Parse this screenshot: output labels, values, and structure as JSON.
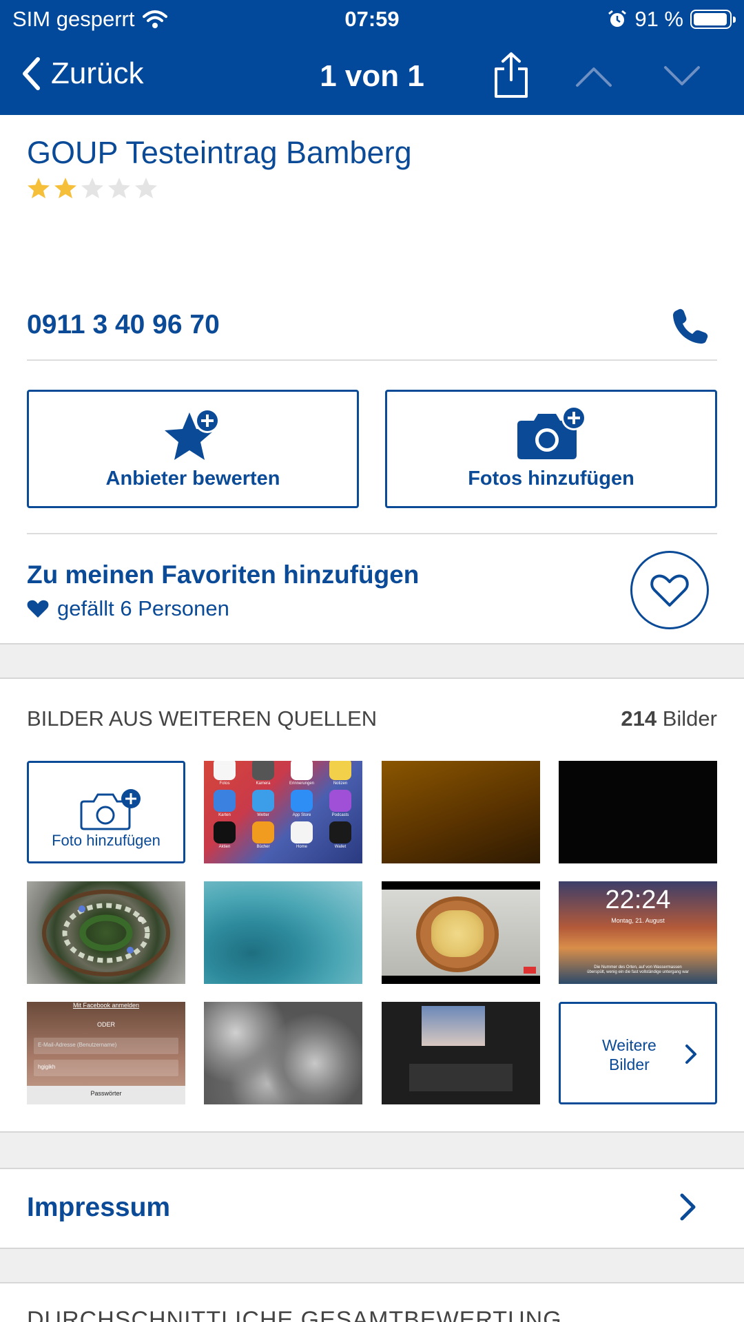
{
  "status": {
    "carrier": "SIM gesperrt",
    "time": "07:59",
    "battery": "91 %"
  },
  "nav": {
    "back_label": "Zurück",
    "title": "1 von 1"
  },
  "listing": {
    "name": "GOUP Testeintrag Bamberg",
    "rating": 2,
    "rating_max": 5
  },
  "phone": {
    "number": "0911 3 40 96 70"
  },
  "actions": {
    "rate_label": "Anbieter bewerten",
    "photos_label": "Fotos hinzufügen"
  },
  "favorites": {
    "title": "Zu meinen Favoriten hinzufügen",
    "likes": "gefällt 6 Personen"
  },
  "images": {
    "heading": "BILDER AUS WEITEREN QUELLEN",
    "count": "214",
    "count_unit": "Bilder",
    "add_photo_label": "Foto hinzufügen",
    "more_label_1": "Weitere",
    "more_label_2": "Bilder",
    "thumbs": {
      "t1": {
        "labels": [
          "Fotos",
          "Kamera",
          "Erinnerungen",
          "Notizen",
          "Karten",
          "Wetter",
          "App Store",
          "Podcasts",
          "Aktien",
          "Bücher",
          "Home",
          "Wallet"
        ]
      },
      "t8": {
        "clock": "22:24",
        "date": "Montag, 21. August",
        "caption": "Die Nummer des Orten, auf von Wassermassen überspült, wenig ein die fast vollständige untergang war"
      },
      "t9": {
        "fb_link": "Mit Facebook anmelden",
        "oder": "ODER",
        "placeholder": "E-Mail-Adresse (Benutzername)",
        "password": "hgigikh",
        "forgot": "Passwörter"
      }
    }
  },
  "impressum": {
    "label": "Impressum"
  },
  "rating_section": {
    "heading": "DURCHSCHNITTLICHE GESAMTBEWERTUNG"
  },
  "colors": {
    "brand": "#03499b",
    "accent": "#0a4a96",
    "star": "#f6bf3a",
    "star_empty": "#e4e4e4"
  }
}
